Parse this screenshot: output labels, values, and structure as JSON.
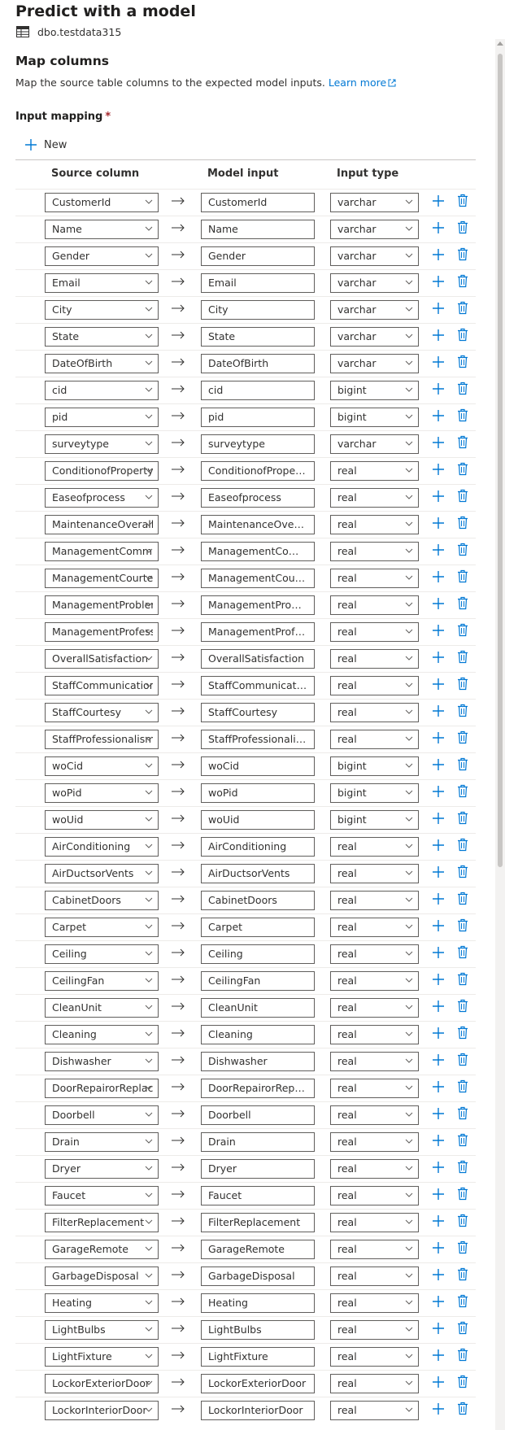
{
  "page": {
    "title": "Predict with a model",
    "table_name": "dbo.testdata315"
  },
  "section": {
    "heading": "Map columns",
    "description": "Map the source table columns to the expected model inputs.",
    "learn_more": "Learn more"
  },
  "mapping": {
    "label": "Input mapping",
    "required_mark": "*",
    "new_label": "New",
    "columns": {
      "source": "Source column",
      "model": "Model input",
      "type": "Input type"
    },
    "rows": [
      {
        "source": "CustomerId",
        "model": "CustomerId",
        "type": "varchar"
      },
      {
        "source": "Name",
        "model": "Name",
        "type": "varchar"
      },
      {
        "source": "Gender",
        "model": "Gender",
        "type": "varchar"
      },
      {
        "source": "Email",
        "model": "Email",
        "type": "varchar"
      },
      {
        "source": "City",
        "model": "City",
        "type": "varchar"
      },
      {
        "source": "State",
        "model": "State",
        "type": "varchar"
      },
      {
        "source": "DateOfBirth",
        "model": "DateOfBirth",
        "type": "varchar"
      },
      {
        "source": "cid",
        "model": "cid",
        "type": "bigint"
      },
      {
        "source": "pid",
        "model": "pid",
        "type": "bigint"
      },
      {
        "source": "surveytype",
        "model": "surveytype",
        "type": "varchar"
      },
      {
        "source": "ConditionofProperty",
        "model": "ConditionofProperty",
        "type": "real"
      },
      {
        "source": "Easeofprocess",
        "model": "Easeofprocess",
        "type": "real"
      },
      {
        "source": "MaintenanceOverallSat",
        "model": "MaintenanceOveral...",
        "type": "real"
      },
      {
        "source": "ManagementCommun",
        "model": "ManagementCom...",
        "type": "real"
      },
      {
        "source": "ManagementCourtesy",
        "model": "ManagementCourt...",
        "type": "real"
      },
      {
        "source": "ManagementProblemR",
        "model": "ManagementProbl...",
        "type": "real"
      },
      {
        "source": "ManagementProfessio",
        "model": "ManagementProfes...",
        "type": "real"
      },
      {
        "source": "OverallSatisfaction",
        "model": "OverallSatisfaction",
        "type": "real"
      },
      {
        "source": "StaffCommunication",
        "model": "StaffCommunication",
        "type": "real"
      },
      {
        "source": "StaffCourtesy",
        "model": "StaffCourtesy",
        "type": "real"
      },
      {
        "source": "StaffProfessionalism",
        "model": "StaffProfessionalism",
        "type": "real"
      },
      {
        "source": "woCid",
        "model": "woCid",
        "type": "bigint"
      },
      {
        "source": "woPid",
        "model": "woPid",
        "type": "bigint"
      },
      {
        "source": "woUid",
        "model": "woUid",
        "type": "bigint"
      },
      {
        "source": "AirConditioning",
        "model": "AirConditioning",
        "type": "real"
      },
      {
        "source": "AirDuctsorVents",
        "model": "AirDuctsorVents",
        "type": "real"
      },
      {
        "source": "CabinetDoors",
        "model": "CabinetDoors",
        "type": "real"
      },
      {
        "source": "Carpet",
        "model": "Carpet",
        "type": "real"
      },
      {
        "source": "Ceiling",
        "model": "Ceiling",
        "type": "real"
      },
      {
        "source": "CeilingFan",
        "model": "CeilingFan",
        "type": "real"
      },
      {
        "source": "CleanUnit",
        "model": "CleanUnit",
        "type": "real"
      },
      {
        "source": "Cleaning",
        "model": "Cleaning",
        "type": "real"
      },
      {
        "source": "Dishwasher",
        "model": "Dishwasher",
        "type": "real"
      },
      {
        "source": "DoorRepairorReplace",
        "model": "DoorRepairorReplace",
        "type": "real"
      },
      {
        "source": "Doorbell",
        "model": "Doorbell",
        "type": "real"
      },
      {
        "source": "Drain",
        "model": "Drain",
        "type": "real"
      },
      {
        "source": "Dryer",
        "model": "Dryer",
        "type": "real"
      },
      {
        "source": "Faucet",
        "model": "Faucet",
        "type": "real"
      },
      {
        "source": "FilterReplacement",
        "model": "FilterReplacement",
        "type": "real"
      },
      {
        "source": "GarageRemote",
        "model": "GarageRemote",
        "type": "real"
      },
      {
        "source": "GarbageDisposal",
        "model": "GarbageDisposal",
        "type": "real"
      },
      {
        "source": "Heating",
        "model": "Heating",
        "type": "real"
      },
      {
        "source": "LightBulbs",
        "model": "LightBulbs",
        "type": "real"
      },
      {
        "source": "LightFixture",
        "model": "LightFixture",
        "type": "real"
      },
      {
        "source": "LockorExteriorDoor",
        "model": "LockorExteriorDoor",
        "type": "real"
      },
      {
        "source": "LockorInteriorDoor",
        "model": "LockorInteriorDoor",
        "type": "real"
      }
    ]
  },
  "colors": {
    "accent": "#0078d4",
    "text": "#323130",
    "border": "#605e5c",
    "required": "#a4262c"
  },
  "icons": {
    "table": "table-icon",
    "external": "external-link-icon",
    "new": "plus-icon",
    "arrow": "arrow-right-icon",
    "add": "plus-icon",
    "delete": "trash-icon",
    "dropdown": "chevron-down-icon"
  }
}
